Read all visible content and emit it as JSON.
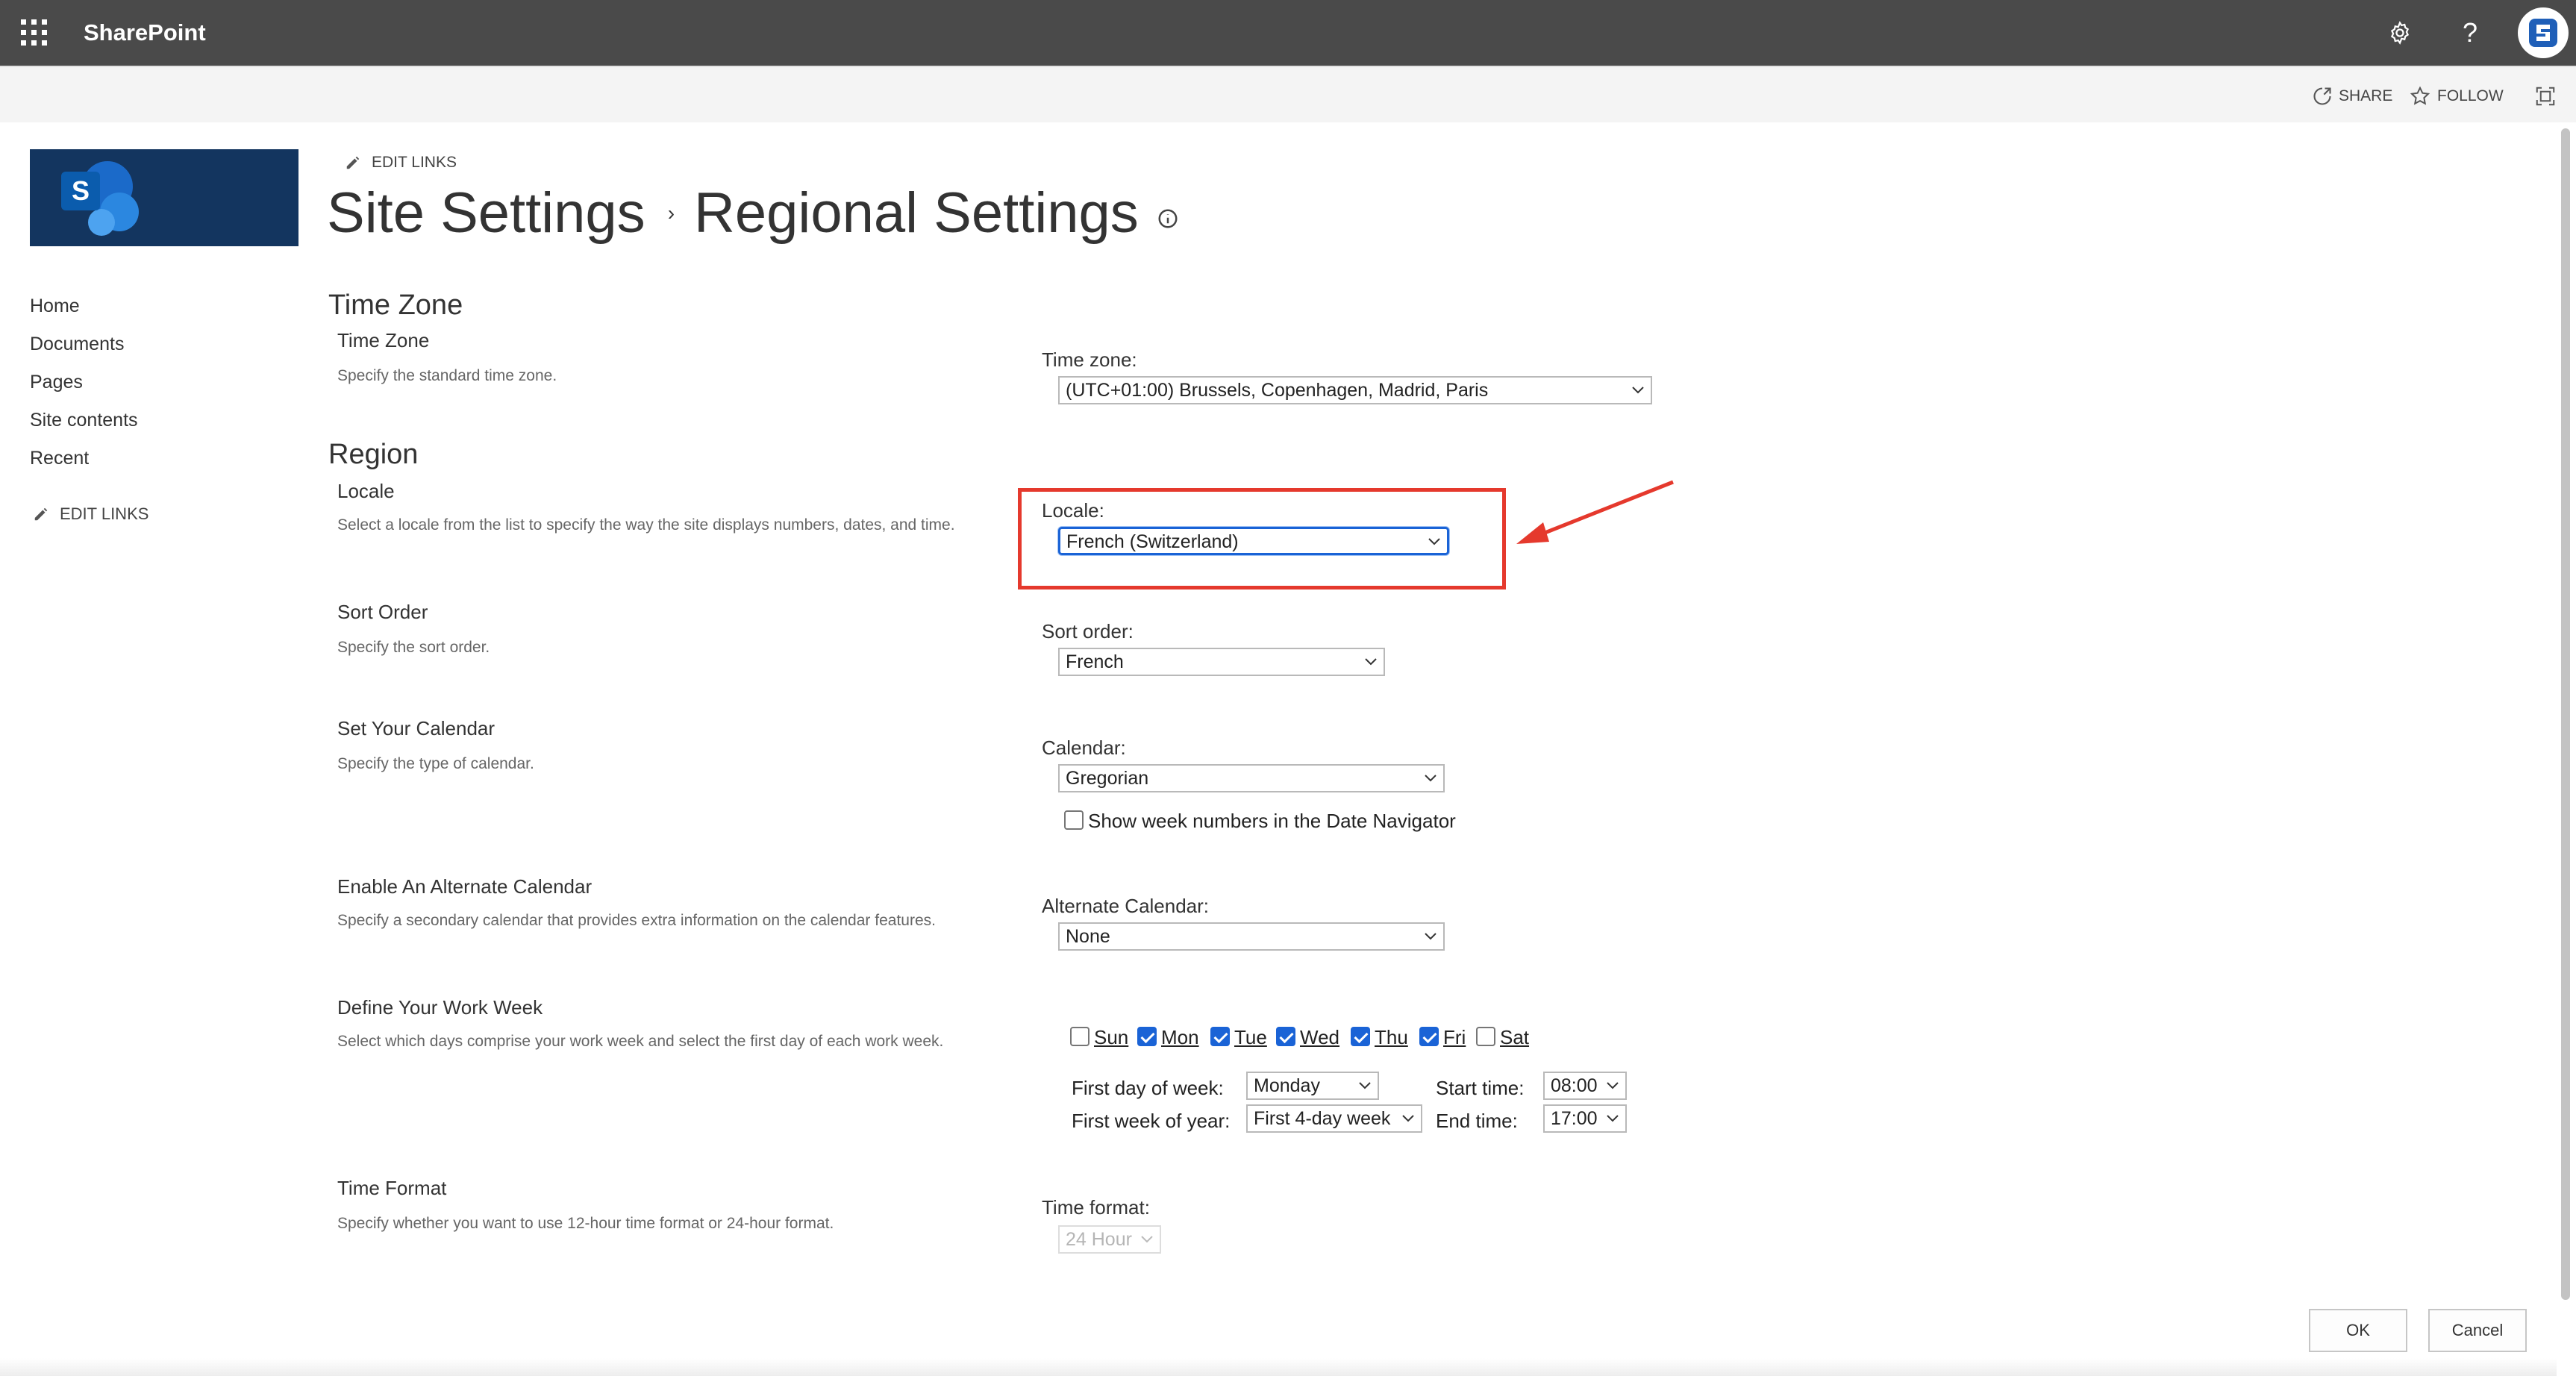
{
  "suitebar": {
    "brand": "SharePoint",
    "icons": [
      "app-launcher-icon",
      "gear-icon",
      "help-icon",
      "avatar"
    ],
    "help_glyph": "?"
  },
  "ribbon": {
    "share": "SHARE",
    "follow": "FOLLOW"
  },
  "site": {
    "logo_letter": "S"
  },
  "nav": {
    "items": [
      "Home",
      "Documents",
      "Pages",
      "Site contents",
      "Recent"
    ],
    "edit_links": "EDIT LINKS"
  },
  "header": {
    "edit_links": "EDIT LINKS",
    "breadcrumb_root": "Site Settings",
    "separator": "›",
    "title": "Regional Settings"
  },
  "time_zone": {
    "section": "Time Zone",
    "title": "Time Zone",
    "desc": "Specify the standard time zone.",
    "label": "Time zone:",
    "value": "(UTC+01:00) Brussels, Copenhagen, Madrid, Paris"
  },
  "region": {
    "section": "Region",
    "locale": {
      "title": "Locale",
      "desc": "Select a locale from the list to specify the way the site displays numbers, dates, and time.",
      "label": "Locale:",
      "value": "French (Switzerland)"
    },
    "sort": {
      "title": "Sort Order",
      "desc": "Specify the sort order.",
      "label": "Sort order:",
      "value": "French"
    },
    "calendar": {
      "title": "Set Your Calendar",
      "desc": "Specify the type of calendar.",
      "label": "Calendar:",
      "value": "Gregorian",
      "week_numbers": "Show week numbers in the Date Navigator",
      "week_numbers_checked": false
    },
    "alt_calendar": {
      "title": "Enable An Alternate Calendar",
      "desc": "Specify a secondary calendar that provides extra information on the calendar features.",
      "label": "Alternate Calendar:",
      "value": "None"
    },
    "work_week": {
      "title": "Define Your Work Week",
      "desc": "Select which days comprise your work week and select the first day of each work week.",
      "days": [
        {
          "label": "Sun",
          "checked": false
        },
        {
          "label": "Mon",
          "checked": true
        },
        {
          "label": "Tue",
          "checked": true
        },
        {
          "label": "Wed",
          "checked": true
        },
        {
          "label": "Thu",
          "checked": true
        },
        {
          "label": "Fri",
          "checked": true
        },
        {
          "label": "Sat",
          "checked": false
        }
      ],
      "first_day_label": "First day of week:",
      "first_day_value": "Monday",
      "first_week_label": "First week of year:",
      "first_week_value": "First 4-day week",
      "start_label": "Start time:",
      "start_value": "08:00",
      "end_label": "End time:",
      "end_value": "17:00"
    },
    "time_format": {
      "title": "Time Format",
      "desc": "Specify whether you want to use 12-hour time format or 24-hour format.",
      "label": "Time format:",
      "value": "24 Hour"
    }
  },
  "buttons": {
    "ok": "OK",
    "cancel": "Cancel"
  },
  "colors": {
    "suitebar": "#4a4a4a",
    "logo_bg": "#13355f",
    "accent": "#1a63d6",
    "annotation": "#e5392d"
  }
}
